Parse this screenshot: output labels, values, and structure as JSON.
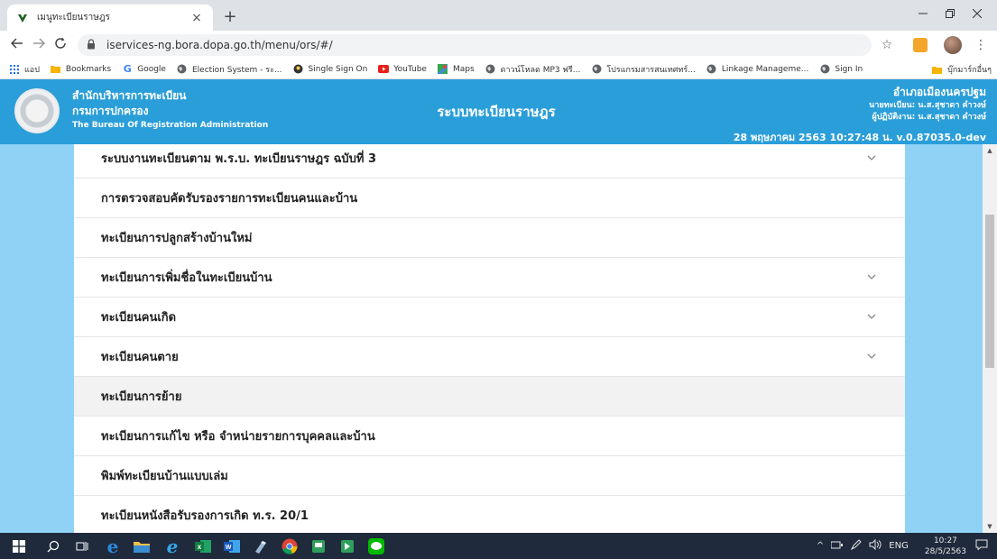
{
  "browser": {
    "tab_title": "เมนูทะเบียนราษฎร",
    "tab_close": "×",
    "new_tab": "+",
    "url": "iservices-ng.bora.dopa.go.th/menu/ors/#/",
    "bookmarks": [
      {
        "icon": "apps-grid-icon",
        "label": "แอป"
      },
      {
        "icon": "folder-icon",
        "label": "Bookmarks"
      },
      {
        "icon": "google-icon",
        "label": "Google"
      },
      {
        "icon": "globe-icon",
        "label": "Election System - ระ..."
      },
      {
        "icon": "sso-icon",
        "label": "Single Sign On"
      },
      {
        "icon": "youtube-icon",
        "label": "YouTube"
      },
      {
        "icon": "maps-icon",
        "label": "Maps"
      },
      {
        "icon": "globe-icon",
        "label": "ดาวน์โหลด MP3 ฟรี..."
      },
      {
        "icon": "globe-icon",
        "label": "โปรแกรมสารสนเทศทร์..."
      },
      {
        "icon": "globe-icon",
        "label": "Linkage Manageme..."
      },
      {
        "icon": "globe-icon",
        "label": "Sign In"
      }
    ],
    "other_bookmarks": "บุ๊กมาร์กอื่นๆ"
  },
  "header": {
    "org_line1": "สำนักบริหารการทะเบียน",
    "org_line2": "กรมการปกครอง",
    "org_line3": "The Bureau Of Registration Administration",
    "system_title": "ระบบทะเบียนราษฎร",
    "location": "อำเภอเมืองนครปฐม",
    "registrar": "นายทะเบียน: น.ส.สุชาดา คำวงษ์",
    "operator": "ผู้ปฏิบัติงาน: น.ส.สุชาดา คำวงษ์",
    "timestamp": "28 พฤษภาคม 2563 10:27:48 น.  v.0.87035.0-dev"
  },
  "menu": {
    "items": [
      {
        "label": "ระบบงานทะเบียนตาม พ.ร.บ. ทะเบียนราษฎร ฉบับที่ 3",
        "expandable": true
      },
      {
        "label": "การตรวจสอบคัดรับรองรายการทะเบียนคนและบ้าน",
        "expandable": false
      },
      {
        "label": "ทะเบียนการปลูกสร้างบ้านใหม่",
        "expandable": false
      },
      {
        "label": "ทะเบียนการเพิ่มชื่อในทะเบียนบ้าน",
        "expandable": true
      },
      {
        "label": "ทะเบียนคนเกิด",
        "expandable": true
      },
      {
        "label": "ทะเบียนคนตาย",
        "expandable": true
      },
      {
        "label": "ทะเบียนการย้าย",
        "expandable": false,
        "active": true
      },
      {
        "label": "ทะเบียนการแก้ไข หรือ จำหน่ายรายการบุคคลและบ้าน",
        "expandable": false
      },
      {
        "label": "พิมพ์ทะเบียนบ้านแบบเล่ม",
        "expandable": false
      },
      {
        "label": "ทะเบียนหนังสือรับรองการเกิด ท.ร. 20/1",
        "expandable": false
      }
    ]
  },
  "taskbar": {
    "lang": "ENG",
    "time": "10:27",
    "date": "28/5/2563"
  },
  "colors": {
    "header_blue": "#2a9ed9",
    "sidebar_blue": "#8fd2f5",
    "taskbar": "#1f2a3c"
  }
}
